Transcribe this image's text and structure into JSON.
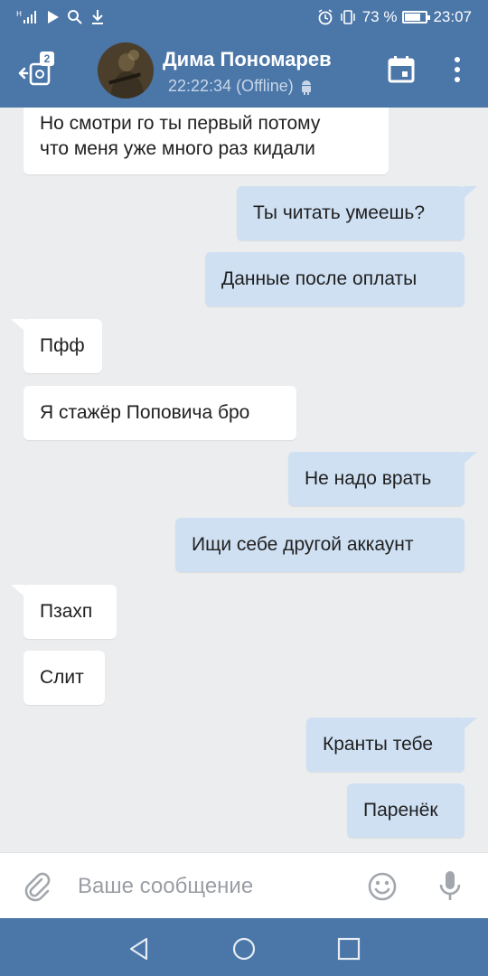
{
  "status_bar": {
    "signal_text": "ᴴ",
    "battery_percent": "73 %",
    "time": "23:07",
    "battery_level": 0.73
  },
  "header": {
    "unread_count": "2",
    "contact_name": "Дима Пономарев",
    "contact_status": "22:22:34 (Offline)"
  },
  "messages": [
    {
      "direction": "in",
      "text_line1": "Но смотри го ты первый потому",
      "text_line2": "что меня уже много раз кидали"
    },
    {
      "direction": "out",
      "text": "Ты читать умеешь?"
    },
    {
      "direction": "out",
      "text": "Данные после оплаты"
    },
    {
      "direction": "in",
      "text": "Пфф"
    },
    {
      "direction": "in",
      "text": "Я стажёр Поповича бро"
    },
    {
      "direction": "out",
      "text": "Не надо врать"
    },
    {
      "direction": "out",
      "text": "Ищи себе другой аккаунт"
    },
    {
      "direction": "in",
      "text": "Пзахп"
    },
    {
      "direction": "in",
      "text": "Слит"
    },
    {
      "direction": "out",
      "text": "Кранты тебе"
    },
    {
      "direction": "out",
      "text": "Паренёк"
    }
  ],
  "input": {
    "placeholder": "Ваше сообщение"
  },
  "colors": {
    "brand": "#4a76a8",
    "incoming_bubble": "#ffffff",
    "outgoing_bubble": "#cfe0f3",
    "background": "#ecedef"
  },
  "icons": {
    "back": "back-arrow-icon",
    "calendar": "calendar-icon",
    "more": "more-vertical-icon",
    "attach": "paperclip-icon",
    "emoji": "emoji-icon",
    "mic": "microphone-icon",
    "android": "android-icon"
  }
}
